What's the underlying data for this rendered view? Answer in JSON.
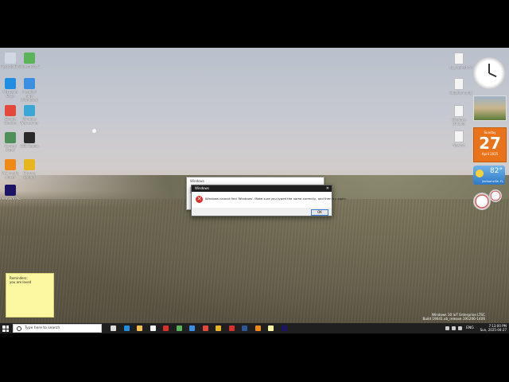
{
  "desktop": {
    "left_icons": [
      {
        "label": "Recycle Bin",
        "name": "recycle-bin-icon",
        "color": "#cfd8e3"
      },
      {
        "label": "Bluestacks 5",
        "name": "bluestacks-icon",
        "color": "#5bb35b"
      },
      {
        "label": "Microsoft Edge",
        "name": "edge-icon",
        "color": "#1f8de0"
      },
      {
        "label": "Installed apps (Windows)",
        "name": "windows-icon",
        "color": "#3a8fe0"
      },
      {
        "label": "Google Chrome",
        "name": "chrome-icon",
        "color": "#e2483c"
      },
      {
        "label": "Windows Web server",
        "name": "web-server-icon",
        "color": "#3aa7d6"
      },
      {
        "label": "Control Panel",
        "name": "control-panel-icon",
        "color": "#4f8f5a"
      },
      {
        "label": "OBS Studio",
        "name": "obs-icon",
        "color": "#2a2a2a"
      },
      {
        "label": "VLC media player",
        "name": "vlc-icon",
        "color": "#f08a17"
      },
      {
        "label": "Chrome Canary",
        "name": "chrome-canary-icon",
        "color": "#e7b51d"
      },
      {
        "label": "Premiere Pro",
        "name": "premiere-icon",
        "color": "#1d1466"
      }
    ],
    "right_icons": [
      {
        "label": "ap_request.txt"
      },
      {
        "label": "CopyItem.png"
      },
      {
        "label": "Windows 10 Color"
      },
      {
        "label": "New.txt"
      }
    ]
  },
  "gadgets": {
    "calendar": {
      "weekday": "Sunday",
      "day": "27",
      "month_year": "April 2025"
    },
    "weather": {
      "temp": "82°",
      "location": "Jacksonville, FL"
    }
  },
  "sticky_note": {
    "line1": "Reminders:",
    "line2": "you are loved"
  },
  "dialog_back": {
    "title": "Windows"
  },
  "dialog": {
    "title": "Windows",
    "message": "Windows cannot find 'Windows'. Make sure you typed the name correctly, and then try again.",
    "ok_label": "OK"
  },
  "watermark": {
    "line1": "Windows 10 IoT Enterprise LTSC",
    "line2": "Build 19041.vb_release.191206-1406"
  },
  "taskbar": {
    "search_placeholder": "Type here to search",
    "language": "ENG",
    "time": "7:13:00 PM",
    "date": "Sun, 2025-04-27",
    "apps": [
      {
        "name": "task-view-icon",
        "color": "#dddddd"
      },
      {
        "name": "edge-taskbar-icon",
        "color": "#1f8de0"
      },
      {
        "name": "file-explorer-icon",
        "color": "#f2c14e"
      },
      {
        "name": "store-icon",
        "color": "#f4f4f4"
      },
      {
        "name": "red-app-icon",
        "color": "#d9302c"
      },
      {
        "name": "green-app-icon",
        "color": "#5bb35b"
      },
      {
        "name": "mail-icon",
        "color": "#3a8fe0"
      },
      {
        "name": "chrome-taskbar-icon",
        "color": "#e2483c"
      },
      {
        "name": "folder-icon",
        "color": "#e7b51d"
      },
      {
        "name": "media-icon",
        "color": "#d9302c"
      },
      {
        "name": "word-icon",
        "color": "#2b5797"
      },
      {
        "name": "vlc-taskbar-icon",
        "color": "#f08a17"
      },
      {
        "name": "notes-icon",
        "color": "#fcf7a1"
      },
      {
        "name": "premiere-taskbar-icon",
        "color": "#1d1466"
      }
    ]
  }
}
